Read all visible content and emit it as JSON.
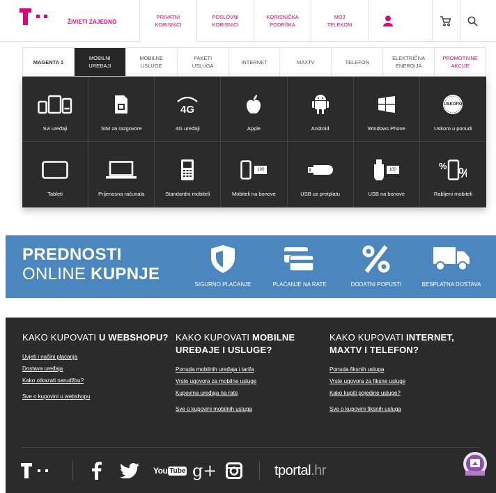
{
  "header": {
    "brand": "ŽIVIETI ZAJEDNO",
    "nav": [
      {
        "label": "PRIVATNI\nKORISNICI"
      },
      {
        "label": "POSLOVNI\nKORISNICI"
      },
      {
        "label": "KORISNIČKA\nPODRŠKA"
      },
      {
        "label": "MOJ\nTELEKOM"
      }
    ],
    "icons": [
      "user-icon",
      "cart-icon",
      "search-icon"
    ],
    "accent": "#e20074"
  },
  "categories": {
    "tabs": [
      {
        "label": "MAGENTA 1"
      },
      {
        "label": "MOBILNI\nUREĐAJI",
        "active": true
      },
      {
        "label": "MOBILNE\nUSLUGE"
      },
      {
        "label": "PAKETI\nUSLUGA"
      },
      {
        "label": "INTERNET"
      },
      {
        "label": "MAXTV"
      },
      {
        "label": "TELEFON"
      },
      {
        "label": "ELEKTRIČNA\nENERGIJA"
      },
      {
        "label": "PROMOTIVNE\nAKCIJE"
      }
    ],
    "items": [
      {
        "label": "Svi uređaji",
        "icon": "devices-icon"
      },
      {
        "label": "SIM za razgovore",
        "icon": "sim-card-icon"
      },
      {
        "label": "4G uređaji",
        "icon": "4g-icon"
      },
      {
        "label": "Apple",
        "icon": "apple-icon"
      },
      {
        "label": "Android",
        "icon": "android-icon"
      },
      {
        "label": "Windows Phone",
        "icon": "windows-icon"
      },
      {
        "label": "Uskoro u ponudi",
        "icon": "uskoro-badge-icon"
      },
      {
        "label": "Tableti",
        "icon": "tablet-icon"
      },
      {
        "label": "Prijenosna računala",
        "icon": "laptop-icon"
      },
      {
        "label": "Standardni mobiteli",
        "icon": "feature-phone-icon"
      },
      {
        "label": "Mobiteli na bonove",
        "icon": "prepaid-phone-icon"
      },
      {
        "label": "USB uz pretplatu",
        "icon": "usb-stick-icon"
      },
      {
        "label": "USB na bonove",
        "icon": "prepaid-usb-icon"
      },
      {
        "label": "Rabljeni mobiteli",
        "icon": "used-phone-percent-icon"
      }
    ],
    "badge_text": "USKORO",
    "bonus_text": "100"
  },
  "banner": {
    "title_line1": "PREDNOSTI",
    "title_line2_regular": "ONLINE ",
    "title_line2_bold": "KUPNJE",
    "benefits": [
      {
        "label": "SIGURNO PLAĆANJE",
        "icon": "shield-icon"
      },
      {
        "label": "PLAĆANJE NA RATE",
        "icon": "credit-cards-icon"
      },
      {
        "label": "DODATNI POPUSTI",
        "icon": "percent-icon"
      },
      {
        "label": "BESPLATNA DOSTAVA",
        "icon": "delivery-truck-icon"
      }
    ],
    "bg_color": "#4c86bf"
  },
  "footer": {
    "columns": [
      {
        "title_regular": "KAKO KUPOVATI ",
        "title_bold": "U WEBSHOPU?",
        "links": [
          "Uvjeti i načini plaćanja",
          "Dostava uređaja",
          "Kako otkazati narudžbu?"
        ],
        "all_link": "Sve o kupovini u webshopu"
      },
      {
        "title_regular": "KAKO KUPOVATI ",
        "title_bold": "MOBILNE UREĐAJE I USLUGE?",
        "links": [
          "Ponuda mobilnih uređaja i tarifa",
          "Vrste ugovora za mobilne usluge",
          "Kupovina uređaja na rate"
        ],
        "all_link": "Sve o kupovini mobilnih usluga"
      },
      {
        "title_regular": "KAKO KUPOVATI ",
        "title_bold": "INTERNET, MAXTV I TELEFON?",
        "links": [
          "Ponuda fiksnih usluga",
          "Vrste ugovora za fiksne usluge",
          "Kako kupiti pojedine usluge?"
        ],
        "all_link": "Sve o kupovini fiksnih usluga"
      }
    ],
    "social": {
      "youtube_text": "You",
      "youtube_tube": "Tube",
      "gplus_text": "g+",
      "tportal_main": "tportal",
      "tportal_suffix": ".hr"
    },
    "bg_color": "#2b2b2b"
  }
}
